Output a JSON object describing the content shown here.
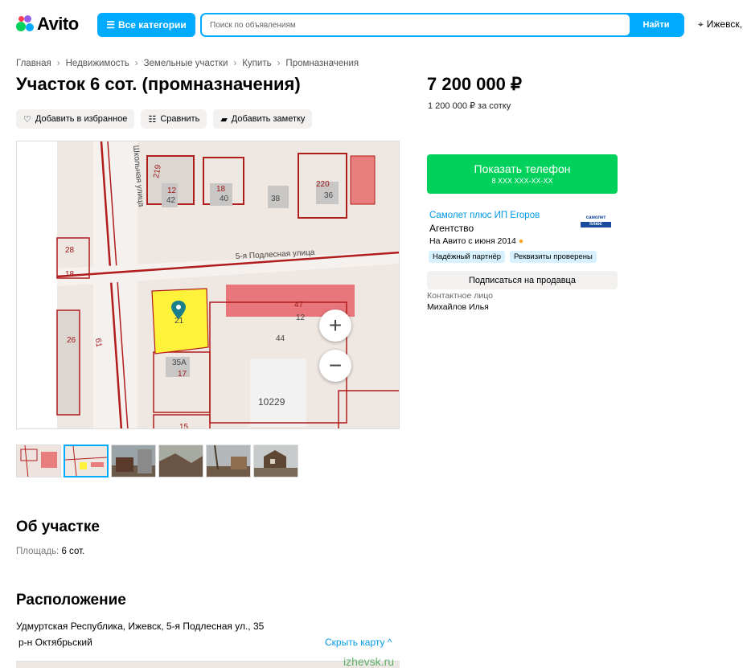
{
  "header": {
    "logo_text": "Avito",
    "categories_label": "Все категории",
    "search_placeholder": "Поиск по объявлениям",
    "search_button": "Найти",
    "location": "Ижевск,"
  },
  "breadcrumbs": [
    "Главная",
    "Недвижимость",
    "Земельные участки",
    "Купить",
    "Промназначения"
  ],
  "listing": {
    "title": "Участок 6 сот. (промназначения)",
    "price": "7 200 000 ₽",
    "price_per": "1 200 000 ₽ за сотку"
  },
  "actions": {
    "favorite": "Добавить в избранное",
    "compare": "Сравнить",
    "note": "Добавить заметку"
  },
  "map_labels": {
    "street_vertical": "Школьная улица",
    "street_horizontal": "5-я Подлесная улица",
    "houses": [
      "219",
      "12",
      "42",
      "18",
      "40",
      "38",
      "220",
      "36",
      "28",
      "18",
      "21",
      "47",
      "12",
      "44",
      "26",
      "61",
      "35А",
      "17",
      "10229",
      "15"
    ]
  },
  "seller": {
    "phone_button": "Показать телефон",
    "phone_masked": "8 XXX XXX-XX-XX",
    "name": "Самолет плюс ИП Егоров",
    "type": "Агентство",
    "since": "На Авито с июня 2014",
    "logo_line1": "самолет",
    "logo_line2": "плюс",
    "badges": [
      "Надёжный партнёр",
      "Реквизиты проверены"
    ],
    "subscribe": "Подписаться на продавца",
    "contact_label": "Контактное лицо",
    "contact_name": "Михайлов Илья"
  },
  "about": {
    "title": "Об участке",
    "area_key": "Площадь:",
    "area_value": "6 сот."
  },
  "location_section": {
    "title": "Расположение",
    "address": "Удмуртская Республика, Ижевск, 5-я Подлесная ул., 35",
    "district": "р-н Октябрьский",
    "hide_map": "Скрыть карту",
    "watermark": "izhevsk.ru"
  },
  "colors": {
    "accent": "#00aaff",
    "phone_green": "#02d15c",
    "link": "#0099e6",
    "badge_bg": "#d7f1ff"
  }
}
